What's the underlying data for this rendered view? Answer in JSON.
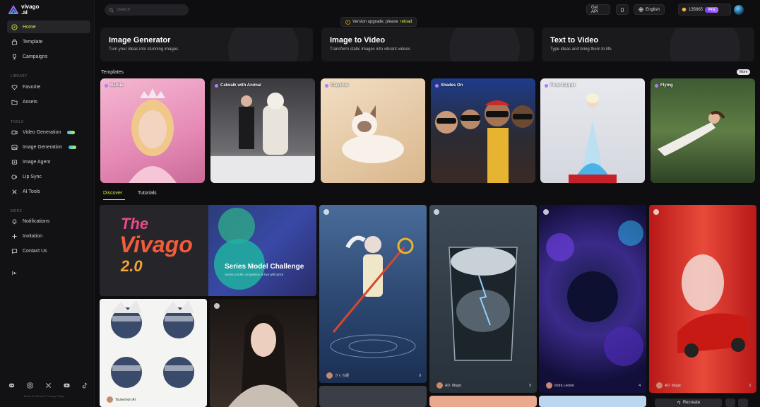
{
  "brand": {
    "name_line1": "vivago",
    "name_line2": ".ai"
  },
  "search": {
    "placeholder": "Search"
  },
  "banner": {
    "text": "Version upgrade, please",
    "link": "reload"
  },
  "header": {
    "get_api": "Get API",
    "language": "English",
    "credits": "135665",
    "plan": "Pro"
  },
  "sidebar": {
    "main": [
      {
        "label": "Home",
        "icon": "compass-icon",
        "active": true
      },
      {
        "label": "Template",
        "icon": "bag-icon"
      },
      {
        "label": "Campaigns",
        "icon": "trophy-icon"
      }
    ],
    "library_label": "Library",
    "library": [
      {
        "label": "Favorite",
        "icon": "heart-icon"
      },
      {
        "label": "Assets",
        "icon": "folder-icon"
      }
    ],
    "tools_label": "Tools",
    "tools": [
      {
        "label": "Video Generation",
        "icon": "video-icon",
        "tag": true
      },
      {
        "label": "Image Generation",
        "icon": "image-icon",
        "tag": true
      },
      {
        "label": "Image Agent",
        "icon": "agent-icon"
      },
      {
        "label": "Lip Sync",
        "icon": "lipsync-icon"
      },
      {
        "label": "AI Tools",
        "icon": "tools-icon"
      }
    ],
    "more_label": "More",
    "more": [
      {
        "label": "Notifications",
        "icon": "bell-icon"
      },
      {
        "label": "Invitation",
        "icon": "plus-icon"
      },
      {
        "label": "Contact Us",
        "icon": "chat-icon"
      }
    ],
    "terms": "Terms of Service / Privacy Policy"
  },
  "features": [
    {
      "title": "Image Generator",
      "subtitle": "Turn your ideas into stunning images"
    },
    {
      "title": "Image to Video",
      "subtitle": "Transform static images into vibrant videos"
    },
    {
      "title": "Text to Video",
      "subtitle": "Type ideas and bring them to life"
    }
  ],
  "templates_heading": "Templates",
  "more_label": "More",
  "templates": [
    "Barbie",
    "Catwalk with Animal",
    "Clayshot",
    "Shades On",
    "Frost Carpet",
    "Flying"
  ],
  "tabs": [
    "Discover",
    "Tutorials"
  ],
  "discover": {
    "challenge_title": "Series Model Challenge",
    "challenge_sub": "Series model competition is live with prize",
    "brand_the": "The",
    "brand_vivago": "Vivago",
    "brand_version": "2.0",
    "tile_user_1": "さくら姫",
    "tile_likes_1": "9",
    "tile_user_2": "AD· Magic",
    "tile_likes_2": "9",
    "tile_user_3": "Indra Leowo",
    "tile_likes_3": "4",
    "tile_user_4": "AD· Magic",
    "tile_likes_4": "3",
    "tile_user_5": "Tsunemon AI",
    "recreate": "Recreate"
  }
}
